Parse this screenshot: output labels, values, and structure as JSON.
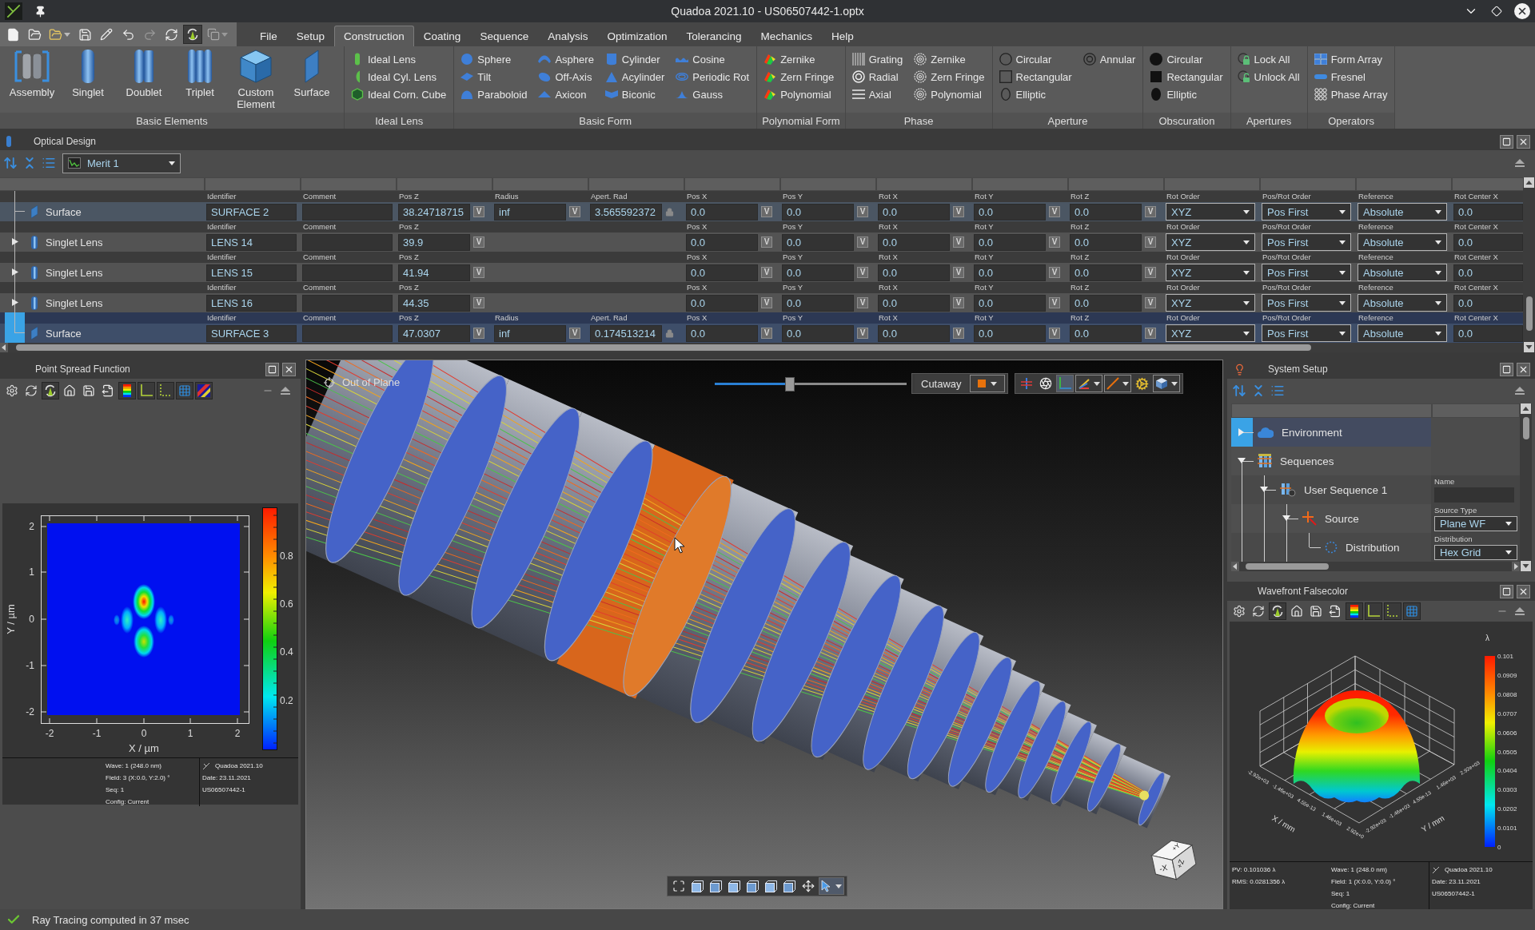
{
  "window": {
    "title": "Quadoa 2021.10 - US06507442-1.optx"
  },
  "quick_access": {
    "redo": {
      "disabled": true
    },
    "auto_update": {
      "on": true
    }
  },
  "menu": {
    "tabs": [
      {
        "label": "File",
        "selected": false
      },
      {
        "label": "Setup",
        "selected": false
      },
      {
        "label": "Construction",
        "selected": true
      },
      {
        "label": "Coating",
        "selected": false
      },
      {
        "label": "Sequence",
        "selected": false
      },
      {
        "label": "Analysis",
        "selected": false
      },
      {
        "label": "Optimization",
        "selected": false
      },
      {
        "label": "Tolerancing",
        "selected": false
      },
      {
        "label": "Mechanics",
        "selected": false
      },
      {
        "label": "Help",
        "selected": false
      }
    ]
  },
  "ribbon": {
    "groups": [
      {
        "title": "Basic Elements",
        "kind": "large",
        "items": [
          "Assembly",
          "Singlet",
          "Doublet",
          "Triplet",
          "Custom Element",
          "Surface"
        ]
      },
      {
        "title": "Ideal Lens",
        "kind": "small",
        "items": [
          "Ideal Lens",
          "Ideal Cyl. Lens",
          "Ideal Corn. Cube"
        ]
      },
      {
        "title": "Basic Form",
        "kind": "small",
        "items": [
          "Sphere",
          "Tilt",
          "Paraboloid",
          "Asphere",
          "Off-Axis",
          "Axicon",
          "Cylinder",
          "Acylinder",
          "Biconic",
          "Cosine",
          "Periodic Rot",
          "Gauss"
        ]
      },
      {
        "title": "Polynomial Form",
        "kind": "small",
        "items": [
          "Zernike",
          "Zern Fringe",
          "Polynomial"
        ]
      },
      {
        "title": "Phase",
        "kind": "small",
        "items": [
          "Grating",
          "Radial",
          "Axial",
          "Zernike",
          "Zern Fringe",
          "Polynomial"
        ]
      },
      {
        "title": "Aperture",
        "kind": "small",
        "items": [
          "Circular",
          "Rectangular",
          "Elliptic",
          "Annular"
        ]
      },
      {
        "title": "Obscuration",
        "kind": "small",
        "items": [
          "Circular",
          "Rectangular",
          "Elliptic"
        ]
      },
      {
        "title": "Apertures",
        "kind": "small",
        "items": [
          "Lock All",
          "Unlock All"
        ]
      },
      {
        "title": "Operators",
        "kind": "small",
        "items": [
          "Form Array",
          "Fresnel",
          "Phase Array"
        ]
      }
    ]
  },
  "optical_design": {
    "title": "Optical Design",
    "merit": "Merit 1",
    "rows": [
      {
        "kind": "surface",
        "label": "Surface",
        "selected": false,
        "cells": [
          {
            "kind": "text",
            "label": "Identifier",
            "value": "SURFACE 2"
          },
          {
            "kind": "text",
            "label": "Comment"
          },
          {
            "kind": "number",
            "label": "Pos Z",
            "value": "38.24718715",
            "toggle": "V",
            "variable": false
          },
          {
            "kind": "number",
            "label": "Radius",
            "value": "inf",
            "toggle": "V",
            "variable": false
          },
          {
            "kind": "locked",
            "label": "Apert. Rad",
            "value": "3.565592372"
          },
          {
            "kind": "number",
            "label": "Pos X",
            "value": "0.0",
            "toggle": "V",
            "variable": false
          },
          {
            "kind": "number",
            "label": "Pos Y",
            "value": "0.0",
            "toggle": "V",
            "variable": false
          },
          {
            "kind": "number",
            "label": "Rot X",
            "value": "0.0",
            "toggle": "V",
            "variable": false
          },
          {
            "kind": "number",
            "label": "Rot Y",
            "value": "0.0",
            "toggle": "V",
            "variable": false
          },
          {
            "kind": "number",
            "label": "Rot Z",
            "value": "0.0",
            "toggle": "V",
            "variable": false
          },
          {
            "kind": "select",
            "label": "Rot Order",
            "value": "XYZ"
          },
          {
            "kind": "select",
            "label": "Pos/Rot Order",
            "value": "Pos First"
          },
          {
            "kind": "select",
            "label": "Reference",
            "value": "Absolute"
          },
          {
            "kind": "text",
            "label": "Rot Center X",
            "value": "0.0"
          }
        ]
      },
      {
        "kind": "lens",
        "label": "Singlet Lens",
        "selected": false,
        "expanded": false,
        "cells": [
          {
            "kind": "text",
            "label": "Identifier",
            "value": "LENS 14"
          },
          {
            "kind": "text",
            "label": "Comment"
          },
          {
            "kind": "number",
            "label": "Pos Z",
            "value": "39.9",
            "toggle": "V",
            "variable": false
          },
          {
            "kind": "blank"
          },
          {
            "kind": "blank"
          },
          {
            "kind": "number",
            "label": "Pos X",
            "value": "0.0",
            "toggle": "V",
            "variable": false
          },
          {
            "kind": "number",
            "label": "Pos Y",
            "value": "0.0",
            "toggle": "V",
            "variable": false
          },
          {
            "kind": "number",
            "label": "Rot X",
            "value": "0.0",
            "toggle": "V",
            "variable": false
          },
          {
            "kind": "number",
            "label": "Rot Y",
            "value": "0.0",
            "toggle": "V",
            "variable": false
          },
          {
            "kind": "number",
            "label": "Rot Z",
            "value": "0.0",
            "toggle": "V",
            "variable": false
          },
          {
            "kind": "select",
            "label": "Rot Order",
            "value": "XYZ"
          },
          {
            "kind": "select",
            "label": "Pos/Rot Order",
            "value": "Pos First"
          },
          {
            "kind": "select",
            "label": "Reference",
            "value": "Absolute"
          },
          {
            "kind": "text",
            "label": "Rot Center X",
            "value": "0.0"
          }
        ]
      },
      {
        "kind": "lens",
        "label": "Singlet Lens",
        "selected": false,
        "expanded": false,
        "cells": [
          {
            "kind": "text",
            "label": "Identifier",
            "value": "LENS 15"
          },
          {
            "kind": "text",
            "label": "Comment"
          },
          {
            "kind": "number",
            "label": "Pos Z",
            "value": "41.94",
            "toggle": "V",
            "variable": false
          },
          {
            "kind": "blank"
          },
          {
            "kind": "blank"
          },
          {
            "kind": "number",
            "label": "Pos X",
            "value": "0.0",
            "toggle": "V",
            "variable": false
          },
          {
            "kind": "number",
            "label": "Pos Y",
            "value": "0.0",
            "toggle": "V",
            "variable": false
          },
          {
            "kind": "number",
            "label": "Rot X",
            "value": "0.0",
            "toggle": "V",
            "variable": false
          },
          {
            "kind": "number",
            "label": "Rot Y",
            "value": "0.0",
            "toggle": "V",
            "variable": false
          },
          {
            "kind": "number",
            "label": "Rot Z",
            "value": "0.0",
            "toggle": "V",
            "variable": false
          },
          {
            "kind": "select",
            "label": "Rot Order",
            "value": "XYZ"
          },
          {
            "kind": "select",
            "label": "Pos/Rot Order",
            "value": "Pos First"
          },
          {
            "kind": "select",
            "label": "Reference",
            "value": "Absolute"
          },
          {
            "kind": "text",
            "label": "Rot Center X",
            "value": "0.0"
          }
        ]
      },
      {
        "kind": "lens",
        "label": "Singlet Lens",
        "selected": false,
        "expanded": false,
        "cells": [
          {
            "kind": "text",
            "label": "Identifier",
            "value": "LENS 16"
          },
          {
            "kind": "text",
            "label": "Comment"
          },
          {
            "kind": "number",
            "label": "Pos Z",
            "value": "44.35",
            "toggle": "V",
            "variable": false
          },
          {
            "kind": "blank"
          },
          {
            "kind": "blank"
          },
          {
            "kind": "number",
            "label": "Pos X",
            "value": "0.0",
            "toggle": "V",
            "variable": false
          },
          {
            "kind": "number",
            "label": "Pos Y",
            "value": "0.0",
            "toggle": "V",
            "variable": false
          },
          {
            "kind": "number",
            "label": "Rot X",
            "value": "0.0",
            "toggle": "V",
            "variable": false
          },
          {
            "kind": "number",
            "label": "Rot Y",
            "value": "0.0",
            "toggle": "V",
            "variable": false
          },
          {
            "kind": "number",
            "label": "Rot Z",
            "value": "0.0",
            "toggle": "V",
            "variable": false
          },
          {
            "kind": "select",
            "label": "Rot Order",
            "value": "XYZ"
          },
          {
            "kind": "select",
            "label": "Pos/Rot Order",
            "value": "Pos First"
          },
          {
            "kind": "select",
            "label": "Reference",
            "value": "Absolute"
          },
          {
            "kind": "text",
            "label": "Rot Center X",
            "value": "0.0"
          }
        ]
      },
      {
        "kind": "surface",
        "label": "Surface",
        "selected": true,
        "cells": [
          {
            "kind": "text",
            "label": "Identifier",
            "value": "SURFACE 3"
          },
          {
            "kind": "text",
            "label": "Comment"
          },
          {
            "kind": "number",
            "label": "Pos Z",
            "value": "47.0307",
            "toggle": "V",
            "variable": false
          },
          {
            "kind": "number",
            "label": "Radius",
            "value": "inf",
            "toggle": "V",
            "variable": false
          },
          {
            "kind": "locked",
            "label": "Apert. Rad",
            "value": "0.174513214"
          },
          {
            "kind": "number",
            "label": "Pos X",
            "value": "0.0",
            "toggle": "V",
            "variable": false
          },
          {
            "kind": "number",
            "label": "Pos Y",
            "value": "0.0",
            "toggle": "V",
            "variable": false
          },
          {
            "kind": "number",
            "label": "Rot X",
            "value": "0.0",
            "toggle": "V",
            "variable": false
          },
          {
            "kind": "number",
            "label": "Rot Y",
            "value": "0.0",
            "toggle": "V",
            "variable": false
          },
          {
            "kind": "number",
            "label": "Rot Z",
            "value": "0.0",
            "toggle": "V",
            "variable": false
          },
          {
            "kind": "select",
            "label": "Rot Order",
            "value": "XYZ"
          },
          {
            "kind": "select",
            "label": "Pos/Rot Order",
            "value": "Pos First"
          },
          {
            "kind": "select",
            "label": "Reference",
            "value": "Absolute"
          },
          {
            "kind": "text",
            "label": "Rot Center X",
            "value": "0.0"
          }
        ]
      }
    ]
  },
  "psf": {
    "title": "Point Spread Function",
    "toolbar": [
      {
        "on": false
      },
      {
        "on": false
      },
      {
        "on": true
      },
      {
        "on": false
      },
      {
        "on": false
      },
      {
        "on": false
      },
      {
        "on": true
      },
      {
        "on": true
      },
      {
        "on": true
      },
      {
        "on": true
      },
      {
        "on": true
      }
    ],
    "plot": {
      "x_label": "X / µm",
      "y_label": "Y / µm",
      "x_ticks": [
        "-2",
        "-1",
        "0",
        "1",
        "2"
      ],
      "y_ticks": [
        "2",
        "1",
        "0",
        "-1",
        "-2"
      ],
      "scale_ticks": [
        "0.8",
        "0.6",
        "0.4",
        "0.2"
      ]
    },
    "info": {
      "middle": [
        "Wave: 1 (248.0 nm)",
        "Field: 3 (X:0.0, Y:2.0) °",
        "Seq: 1",
        "Config: Current"
      ],
      "right": [
        "Quadoa 2021.10",
        "Date: 23.11.2021",
        "US06507442-1"
      ]
    }
  },
  "viewport": {
    "view_label": "Out of Plane",
    "slider": {
      "level": 0.39
    },
    "cutaway": "Cutaway",
    "tools": [
      {
        "on": false
      },
      {
        "on": false
      },
      {
        "on": true
      },
      {
        "on": false
      },
      {
        "on": false
      },
      {
        "on": false
      },
      {
        "on": false
      }
    ],
    "bottom_tools": [
      {
        "on": false
      },
      {
        "on": false
      },
      {
        "on": false
      },
      {
        "on": false
      },
      {
        "on": false
      },
      {
        "on": false
      },
      {
        "on": false
      },
      {
        "on": false
      },
      {
        "on": true
      }
    ],
    "cube_labels": [
      "-X",
      "+Y",
      "+Z"
    ]
  },
  "system_setup": {
    "title": "System Setup",
    "tree": [
      {
        "label": "Environment",
        "selected": true,
        "expanded": false
      },
      {
        "label": "Sequences",
        "selected": false,
        "expanded": true,
        "children": [
          {
            "label": "User Sequence 1",
            "selected": false,
            "expanded": true,
            "property": {
              "kind": "field",
              "label": "Name"
            },
            "children": [
              {
                "label": "Source",
                "selected": false,
                "expanded": true,
                "property": {
                  "kind": "select",
                  "label": "Source Type",
                  "value": "Plane WF"
                },
                "children": [
                  {
                    "label": "Distribution",
                    "selected": false,
                    "property": {
                      "kind": "select",
                      "label": "Distribution",
                      "value": "Hex Grid"
                    }
                  }
                ]
              }
            ]
          }
        ]
      }
    ]
  },
  "wavefront": {
    "title": "Wavefront Falsecolor",
    "toolbar": [
      {
        "on": false
      },
      {
        "on": false
      },
      {
        "on": true
      },
      {
        "on": false
      },
      {
        "on": false
      },
      {
        "on": false
      },
      {
        "on": true
      },
      {
        "on": true
      },
      {
        "on": true
      },
      {
        "on": true
      }
    ],
    "plot": {
      "unit": "λ",
      "scale_ticks": [
        "0.101",
        "0.0909",
        "0.0808",
        "0.0707",
        "0.0606",
        "0.0505",
        "0.0404",
        "0.0303",
        "0.0202",
        "0.0101",
        "0"
      ],
      "x_ticks": [
        "-2.92e+03",
        "-1.46e+03",
        "4.55e-13",
        "1.46e+03",
        "2.92e+0"
      ],
      "y_ticks": [
        "-2.92e+03",
        "-1.46e+03",
        "4.55e-13",
        "1.46e+03",
        "2.92e+03"
      ],
      "x_label": "X / mm",
      "y_label": "Y / mm"
    },
    "info": {
      "left": [
        "PV: 0.101036 λ",
        "RMS: 0.0281356 λ"
      ],
      "middle": [
        "Wave: 1 (248.0 nm)",
        "Field: 1 (X:0.0, Y:0.0) °",
        "Seq: 1",
        "Config: Current"
      ],
      "right": [
        "Quadoa 2021.10",
        "Date: 23.11.2021",
        "US06507442-1"
      ]
    }
  },
  "status_bar": {
    "message": "Ray Tracing computed in 37 msec"
  }
}
